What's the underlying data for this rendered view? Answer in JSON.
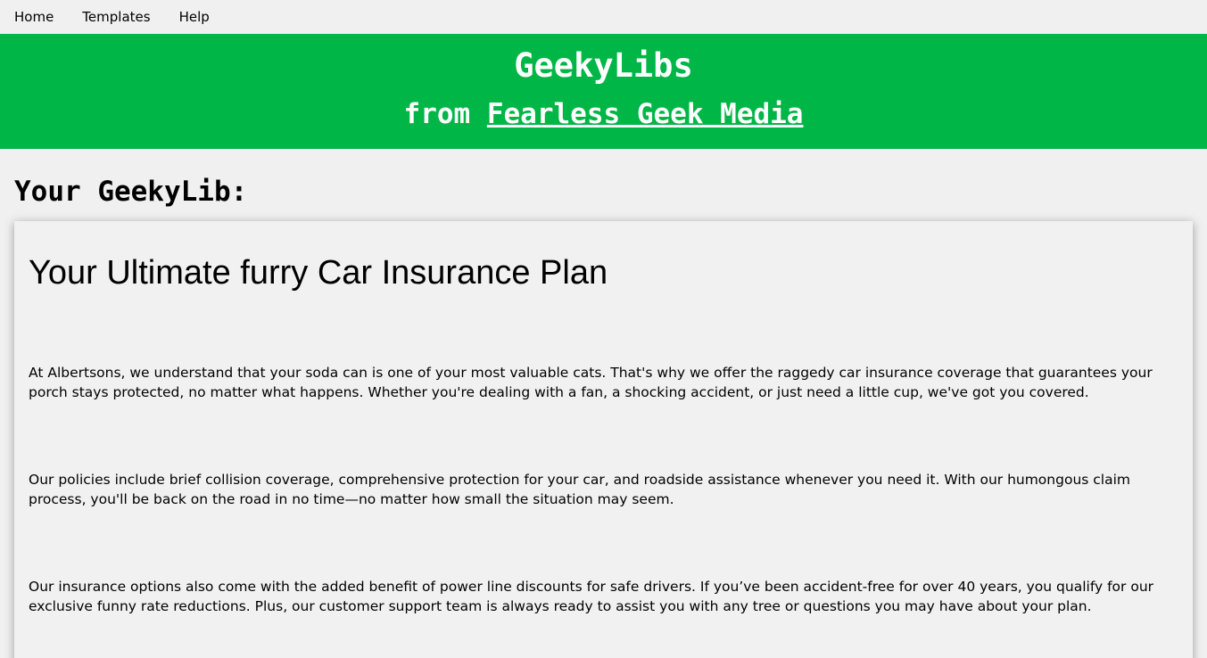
{
  "nav": {
    "items": [
      {
        "label": "Home"
      },
      {
        "label": "Templates"
      },
      {
        "label": "Help"
      }
    ]
  },
  "banner": {
    "title": "GeekyLibs",
    "subtitle_prefix": "from ",
    "subtitle_link": "Fearless Geek Media",
    "background_color": "#00b646"
  },
  "main": {
    "heading": "Your GeekyLib:",
    "card": {
      "title": "Your Ultimate furry Car Insurance Plan",
      "paragraphs": [
        "At Albertsons, we understand that your soda can is one of your most valuable cats. That's why we offer the raggedy car insurance coverage that guarantees your porch stays protected, no matter what happens. Whether you're dealing with a fan, a shocking accident, or just need a little cup, we've got you covered.",
        "Our policies include brief collision coverage, comprehensive protection for your car, and roadside assistance whenever you need it. With our humongous claim process, you'll be back on the road in no time—no matter how small the situation may seem.",
        "Our insurance options also come with the added benefit of power line discounts for safe drivers. If you’ve been accident-free for over 40 years, you qualify for our exclusive funny rate reductions. Plus, our customer support team is always ready to assist you with any tree or questions you may have about your plan."
      ]
    }
  }
}
